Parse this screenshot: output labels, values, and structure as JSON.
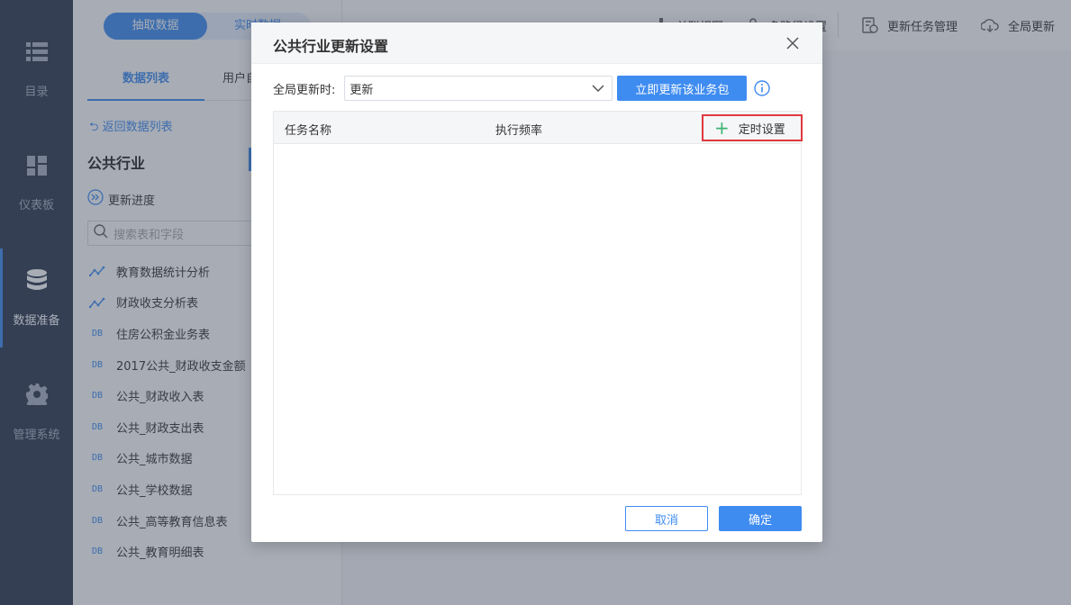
{
  "rail": {
    "items": [
      {
        "label": "目录",
        "icon": "list-icon"
      },
      {
        "label": "仪表板",
        "icon": "dashboard-icon"
      },
      {
        "label": "数据准备",
        "icon": "database-icon"
      },
      {
        "label": "管理系统",
        "icon": "gear-icon"
      }
    ]
  },
  "panel": {
    "mode_on": "抽取数据",
    "mode_off": "实时数据",
    "tabs": [
      "数据列表",
      "用户自"
    ],
    "back_link": "返回数据列表",
    "package_title": "公共行业",
    "progress_label": "更新进度",
    "search_placeholder": "搜索表和字段",
    "tables": [
      {
        "name": "教育数据统计分析",
        "type": "analysis"
      },
      {
        "name": "财政收支分析表",
        "type": "analysis"
      },
      {
        "name": "住房公积金业务表",
        "type": "db"
      },
      {
        "name": "2017公共_财政收支金额",
        "type": "db"
      },
      {
        "name": "公共_财政收入表",
        "type": "db"
      },
      {
        "name": "公共_财政支出表",
        "type": "db"
      },
      {
        "name": "公共_城市数据",
        "type": "db"
      },
      {
        "name": "公共_学校数据",
        "type": "db"
      },
      {
        "name": "公共_高等教育信息表",
        "type": "db"
      },
      {
        "name": "公共_教育明细表",
        "type": "db"
      }
    ],
    "db_tag": "DB"
  },
  "toolbar": {
    "items": [
      "关联视图",
      "多路径设置",
      "更新任务管理",
      "全局更新"
    ]
  },
  "dialog": {
    "title": "公共行业更新设置",
    "global_update_label": "全局更新时:",
    "global_update_value": "更新",
    "update_now_label": "立即更新该业务包",
    "columns": [
      "任务名称",
      "执行频率"
    ],
    "schedule_label": "定时设置",
    "cancel_label": "取消",
    "ok_label": "确定"
  },
  "colors": {
    "accent": "#3f8cf1",
    "rail_bg": "#2e3a4f",
    "highlight_border": "#e0383e",
    "plus_green": "#3cb371"
  }
}
